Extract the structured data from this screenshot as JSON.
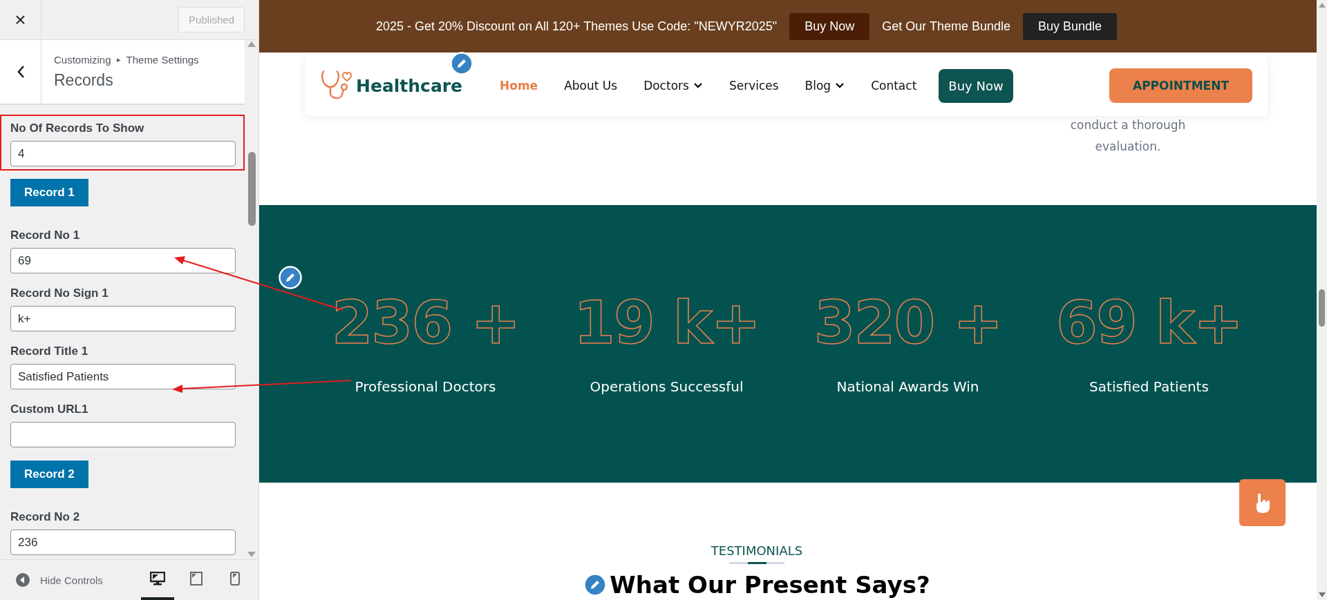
{
  "customizer": {
    "close": "×",
    "publish_button": {
      "label": "Published",
      "disabled": true
    },
    "breadcrumb": {
      "parent": "Customizing",
      "separator": "▸",
      "section": "Theme Settings"
    },
    "title": "Records",
    "controls": [
      {
        "kind": "field",
        "label": "No Of Records To Show",
        "value": "4",
        "highlighted": true
      },
      {
        "kind": "heading",
        "label": "Record 1"
      },
      {
        "kind": "field",
        "label": "Record No 1",
        "value": "69",
        "highlighted": false
      },
      {
        "kind": "field",
        "label": "Record No Sign 1",
        "value": "k+",
        "highlighted": false
      },
      {
        "kind": "field",
        "label": "Record Title 1",
        "value": "Satisfied Patients",
        "highlighted": false
      },
      {
        "kind": "field",
        "label": "Custom URL1",
        "highlighted": false
      },
      {
        "kind": "heading",
        "label": "Record 2"
      },
      {
        "kind": "field",
        "label": "Record No 2",
        "value": "236",
        "highlighted": false
      }
    ],
    "footer": {
      "hide_controls": "Hide Controls",
      "devices": [
        {
          "kind": "desktop",
          "selected": true
        },
        {
          "kind": "tablet",
          "selected": false
        },
        {
          "kind": "mobile",
          "selected": false
        }
      ]
    }
  },
  "preview": {
    "promo_bar": {
      "text": "2025 - Get 20% Discount on All 120+ Themes Use Code: \"NEWYR2025\"",
      "buy_now": "Buy Now",
      "bundle_text": "Get Our Theme Bundle",
      "buy_bundle": "Buy Bundle"
    },
    "header": {
      "logo": "Healthcare",
      "nav": [
        {
          "label": "Home",
          "selected": true,
          "dropdown": false
        },
        {
          "label": "About Us",
          "selected": false,
          "dropdown": false
        },
        {
          "label": "Doctors",
          "selected": false,
          "dropdown": true
        },
        {
          "label": "Services",
          "selected": false,
          "dropdown": false
        },
        {
          "label": "Blog",
          "selected": false,
          "dropdown": true
        },
        {
          "label": "Contact",
          "selected": false,
          "dropdown": false
        }
      ],
      "buy_now": "Buy Now",
      "appointment": "APPOINTMENT"
    },
    "intro_text": "conduct a thorough evaluation.",
    "stats": [
      {
        "number": "236",
        "sign": "+",
        "title": "Professional Doctors"
      },
      {
        "number": "19",
        "sign": "k+",
        "title": "Operations Successful"
      },
      {
        "number": "320",
        "sign": "+",
        "title": "National Awards Win"
      },
      {
        "number": "69",
        "sign": "k+",
        "title": "Satisfied Patients"
      }
    ],
    "testimonials": {
      "eyebrow": "TESTIMONIALS",
      "heading": "What Our Present Says?"
    }
  }
}
